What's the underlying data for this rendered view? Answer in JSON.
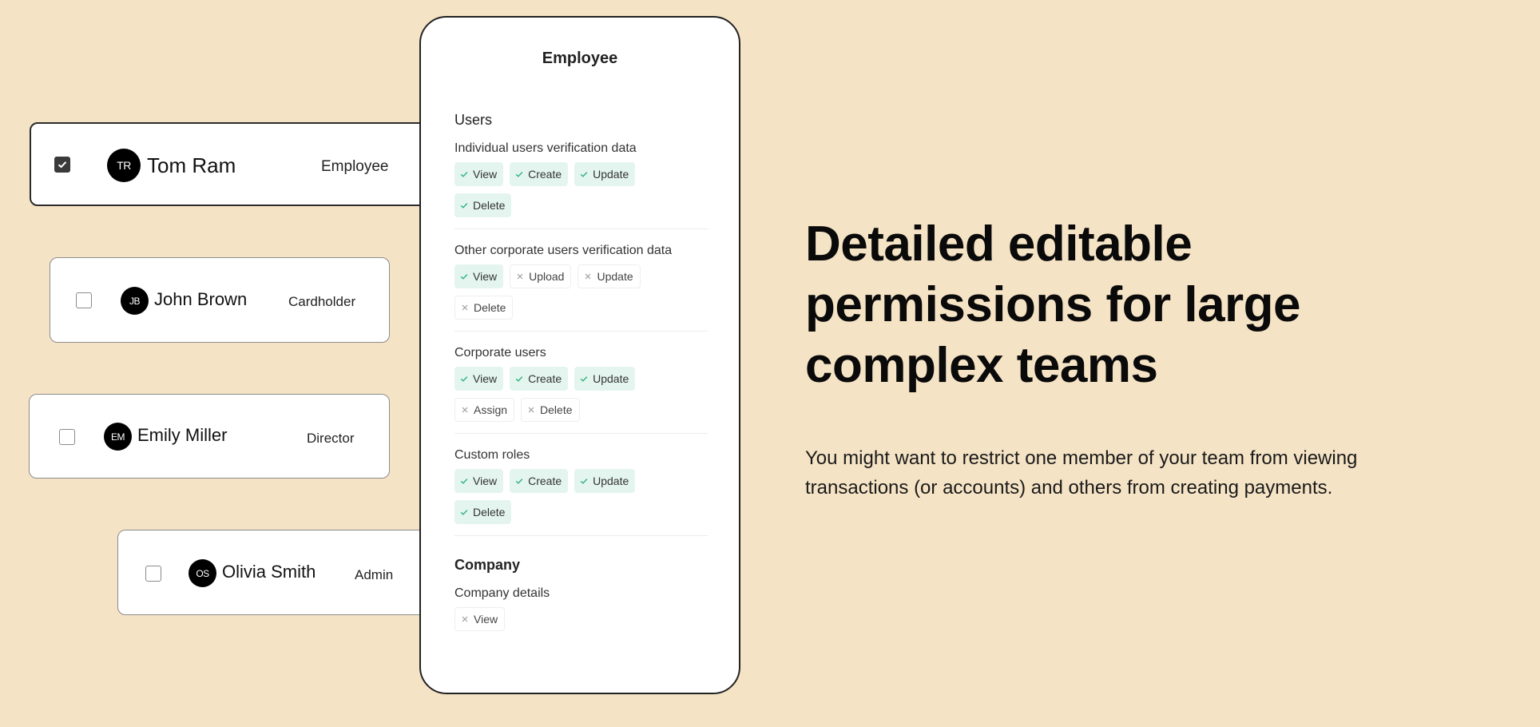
{
  "users": [
    {
      "initials": "TR",
      "name": "Tom Ram",
      "role": "Employee",
      "selected": true
    },
    {
      "initials": "JB",
      "name": "John Brown",
      "role": "Cardholder",
      "selected": false
    },
    {
      "initials": "EM",
      "name": "Emily Miller",
      "role": "Director",
      "selected": false
    },
    {
      "initials": "OS",
      "name": "Olivia Smith",
      "role": "Admin",
      "selected": false
    }
  ],
  "permissions_panel": {
    "title": "Employee",
    "sections": [
      {
        "title": "Users",
        "blocks": [
          {
            "label": "Individual users verification data",
            "chips": [
              {
                "label": "View",
                "granted": true,
                "icon": "check-icon"
              },
              {
                "label": "Create",
                "granted": true,
                "icon": "check-icon"
              },
              {
                "label": "Update",
                "granted": true,
                "icon": "check-icon"
              },
              {
                "label": "Delete",
                "granted": true,
                "icon": "check-icon"
              }
            ]
          },
          {
            "label": "Other corporate users verification data",
            "chips": [
              {
                "label": "View",
                "granted": true,
                "icon": "check-icon"
              },
              {
                "label": "Upload",
                "granted": false,
                "icon": "cross-icon"
              },
              {
                "label": "Update",
                "granted": false,
                "icon": "cross-icon"
              },
              {
                "label": "Delete",
                "granted": false,
                "icon": "cross-icon"
              }
            ]
          },
          {
            "label": "Corporate users",
            "chips": [
              {
                "label": "View",
                "granted": true,
                "icon": "check-icon"
              },
              {
                "label": "Create",
                "granted": true,
                "icon": "check-icon"
              },
              {
                "label": "Update",
                "granted": true,
                "icon": "check-icon"
              },
              {
                "label": "Assign",
                "granted": false,
                "icon": "cross-icon"
              },
              {
                "label": "Delete",
                "granted": false,
                "icon": "cross-icon"
              }
            ]
          },
          {
            "label": "Custom roles",
            "chips": [
              {
                "label": "View",
                "granted": true,
                "icon": "check-icon"
              },
              {
                "label": "Create",
                "granted": true,
                "icon": "check-icon"
              },
              {
                "label": "Update",
                "granted": true,
                "icon": "check-icon"
              },
              {
                "label": "Delete",
                "granted": true,
                "icon": "check-icon"
              }
            ]
          }
        ]
      },
      {
        "title": "Company",
        "blocks": [
          {
            "label": "Company details",
            "chips": [
              {
                "label": "View",
                "granted": false,
                "icon": "cross-icon"
              }
            ]
          }
        ]
      }
    ]
  },
  "hero": {
    "headline": "Detailed editable permissions for large complex teams",
    "body": "You might want to restrict one member of your team from viewing transactions (or accounts) and others from creating payments."
  },
  "colors": {
    "background": "#f5e3c5",
    "granted_chip_bg": "#e4f5ef",
    "granted_icon": "#2bb37a",
    "denied_icon": "#9a9a9a"
  }
}
